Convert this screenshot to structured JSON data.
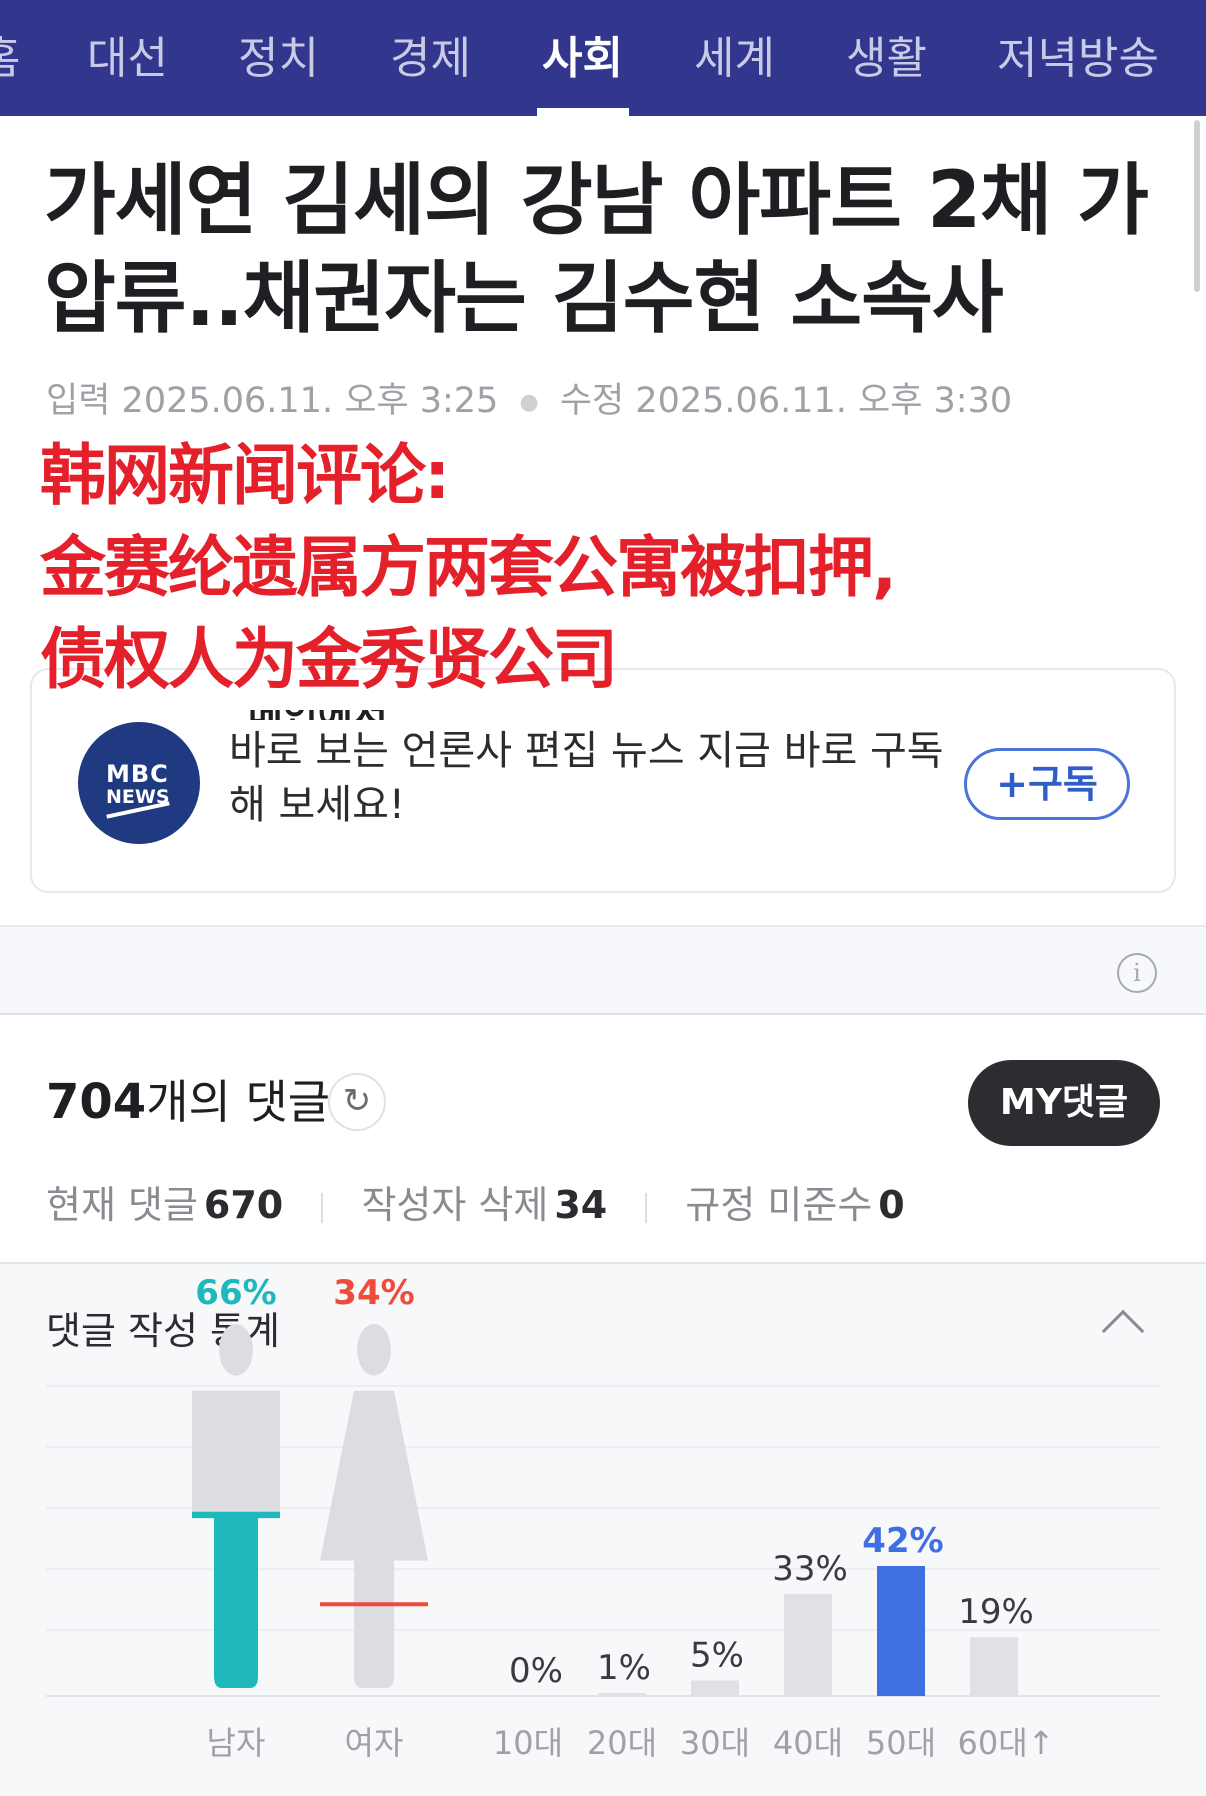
{
  "nav": {
    "items": [
      "홈",
      "대선",
      "정치",
      "경제",
      "사회",
      "세계",
      "생활",
      "저녁방송"
    ],
    "active": "사회"
  },
  "article": {
    "headline_line1": "가세연 김세의 강남 아파트 2채 가",
    "headline_line2": "압류..채권자는 김수현 소속사",
    "input_label": "입력",
    "input_date": "2025.06.11. 오후 3:25",
    "edit_label": "수정",
    "edit_date": "2025.06.11. 오후 3:30"
  },
  "overlay": {
    "line1": "韩网新闻评论:",
    "line2": "金赛纶遗属方两套公寓被扣押,",
    "line3": "债权人为金秀贤公司"
  },
  "subscribe": {
    "logo_line1": "MBC",
    "logo_line2": "NEWS",
    "cut_text": "메인에서",
    "text": "바로 보는 언론사 편집 뉴스 지금 바로 구독해 보세요!",
    "button": "+구독"
  },
  "comments": {
    "count": "704",
    "title_suffix": "개의 댓글",
    "my_button": "MY댓글",
    "current_label": "현재 댓글",
    "current_value": "670",
    "deleted_label": "작성자 삭제",
    "deleted_value": "34",
    "violation_label": "규정 미준수",
    "violation_value": "0"
  },
  "stats": {
    "title": "댓글 작성 통계"
  },
  "colors": {
    "nav_bg": "#32368c",
    "male": "#1fb8bd",
    "female": "#ee4b3b",
    "age_highlight": "#3f6fe0",
    "bar_gray": "#dfe1e5",
    "overlay_red": "#e4202a"
  },
  "chart_data": [
    {
      "type": "bar",
      "title": "",
      "categories": [
        "남자",
        "여자"
      ],
      "values": [
        66,
        34
      ],
      "value_labels": [
        "66%",
        "34%"
      ],
      "unit": "%"
    },
    {
      "type": "bar",
      "title": "",
      "categories": [
        "10대",
        "20대",
        "30대",
        "40대",
        "50대",
        "60대↑"
      ],
      "values": [
        0,
        1,
        5,
        33,
        42,
        19
      ],
      "value_labels": [
        "0%",
        "1%",
        "5%",
        "33%",
        "42%",
        "19%"
      ],
      "highlight": "50대",
      "unit": "%"
    }
  ]
}
